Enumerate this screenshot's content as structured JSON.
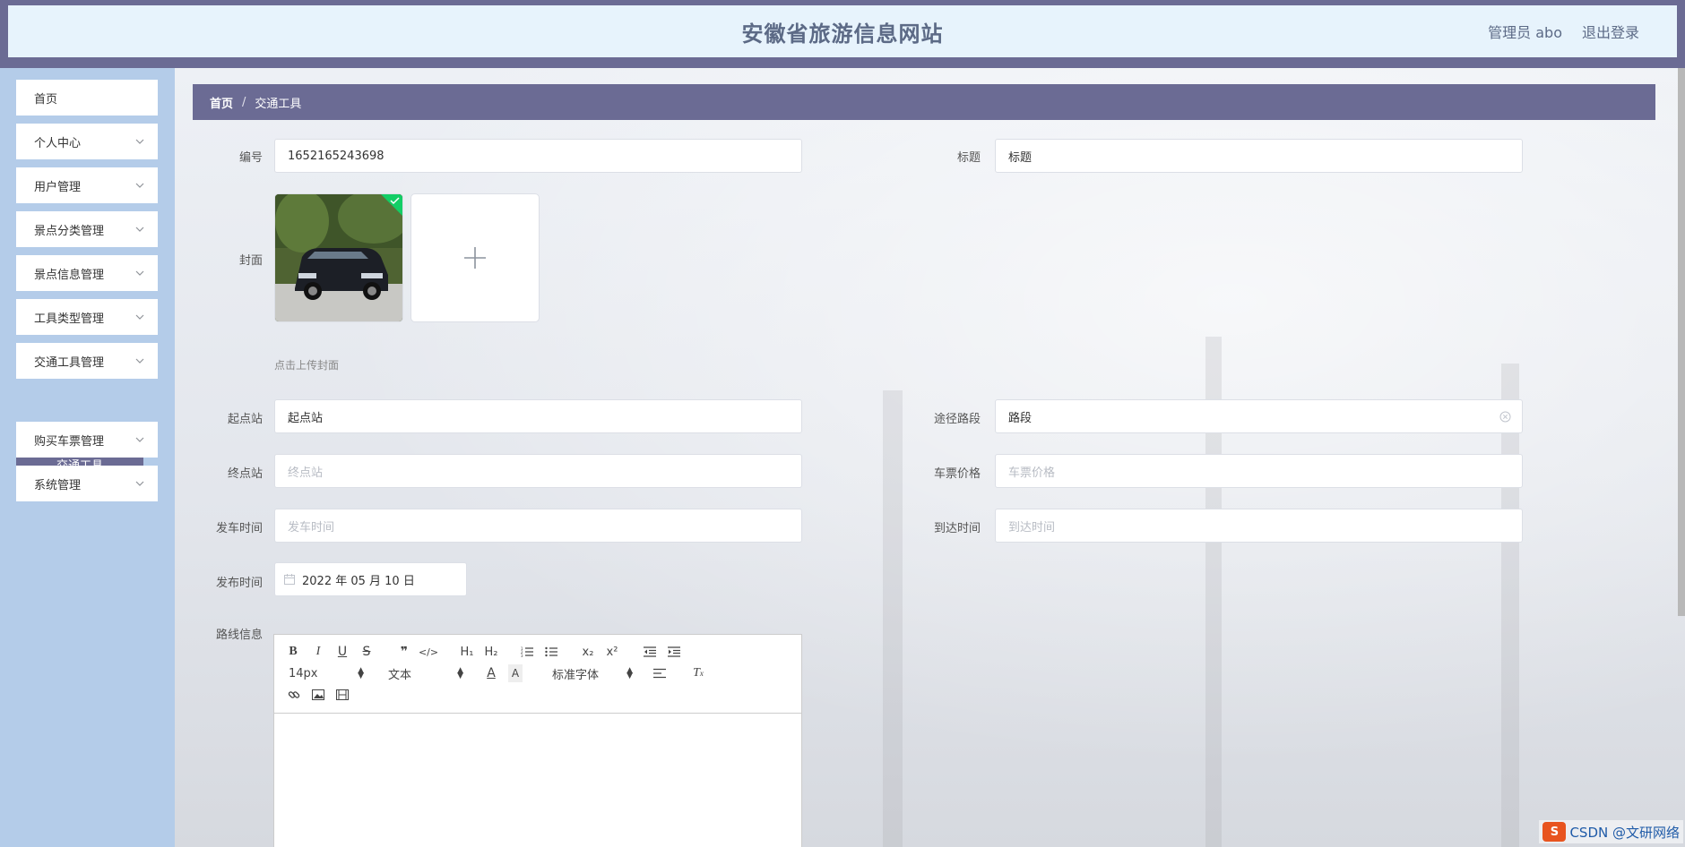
{
  "header": {
    "site_title": "安徽省旅游信息网站",
    "user_label": "管理员 abo",
    "logout_label": "退出登录"
  },
  "sidebar": {
    "items": [
      {
        "label": "首页"
      },
      {
        "label": "个人中心"
      },
      {
        "label": "用户管理"
      },
      {
        "label": "景点分类管理"
      },
      {
        "label": "景点信息管理"
      },
      {
        "label": "工具类型管理"
      },
      {
        "label": "交通工具管理"
      },
      {
        "label": "购买车票管理"
      },
      {
        "label": "系统管理"
      }
    ],
    "active_sub": "交通工具"
  },
  "breadcrumb": {
    "home": "首页",
    "sep": "/",
    "current": "交通工具"
  },
  "form": {
    "code_label": "编号",
    "code_value": "1652165243698",
    "title_label": "标题",
    "title_value": "标题",
    "cover_label": "封面",
    "cover_hint": "点击上传封面",
    "start_label": "起点站",
    "start_value": "起点站",
    "route_label": "途径路段",
    "route_value": "路段",
    "end_label": "终点站",
    "end_placeholder": "终点站",
    "price_label": "车票价格",
    "price_placeholder": "车票价格",
    "depart_label": "发车时间",
    "depart_placeholder": "发车时间",
    "arrive_label": "到达时间",
    "arrive_placeholder": "到达时间",
    "publish_label": "发布时间",
    "publish_value": "2022 年 05 月 10 日",
    "routeinfo_label": "路线信息"
  },
  "editor": {
    "font_size": "14px",
    "block_type": "文本",
    "font_family": "标准字体"
  },
  "watermark": {
    "logo": "S",
    "text": "CSDN @文研网络"
  },
  "colors": {
    "accent": "#6b6b94",
    "sidebar_bg": "#b4cce9",
    "header_bg": "#e7f3fc",
    "success": "#13ce66"
  }
}
